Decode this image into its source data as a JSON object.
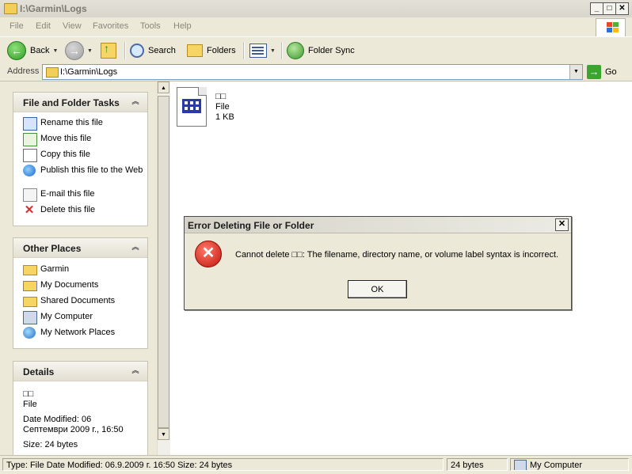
{
  "window": {
    "title": "I:\\Garmin\\Logs"
  },
  "menu": [
    "File",
    "Edit",
    "View",
    "Favorites",
    "Tools",
    "Help"
  ],
  "toolbar": {
    "back": "Back",
    "search": "Search",
    "folders": "Folders",
    "folder_sync": "Folder Sync"
  },
  "address": {
    "label": "Address",
    "path": "I:\\Garmin\\Logs",
    "go": "Go"
  },
  "tasks": {
    "title": "File and Folder Tasks",
    "items": [
      "Rename this file",
      "Move this file",
      "Copy this file",
      "Publish this file to the Web",
      "E-mail this file",
      "Delete this file"
    ]
  },
  "places": {
    "title": "Other Places",
    "items": [
      "Garmin",
      "My Documents",
      "Shared Documents",
      "My Computer",
      "My Network Places"
    ]
  },
  "details": {
    "title": "Details",
    "name": "□□",
    "type": "File",
    "modified": "Date Modified: 06 Септември 2009 г., 16:50",
    "size": "Size: 24 bytes"
  },
  "file": {
    "name": "□□",
    "type": "File",
    "size": "1 KB"
  },
  "dialog": {
    "title": "Error Deleting File or Folder",
    "message": "Cannot delete □□: The filename, directory name, or volume label syntax is incorrect.",
    "ok": "OK"
  },
  "status": {
    "info": "Type: File Date Modified: 06.9.2009 г. 16:50 Size: 24 bytes",
    "size": "24 bytes",
    "zone": "My Computer"
  }
}
